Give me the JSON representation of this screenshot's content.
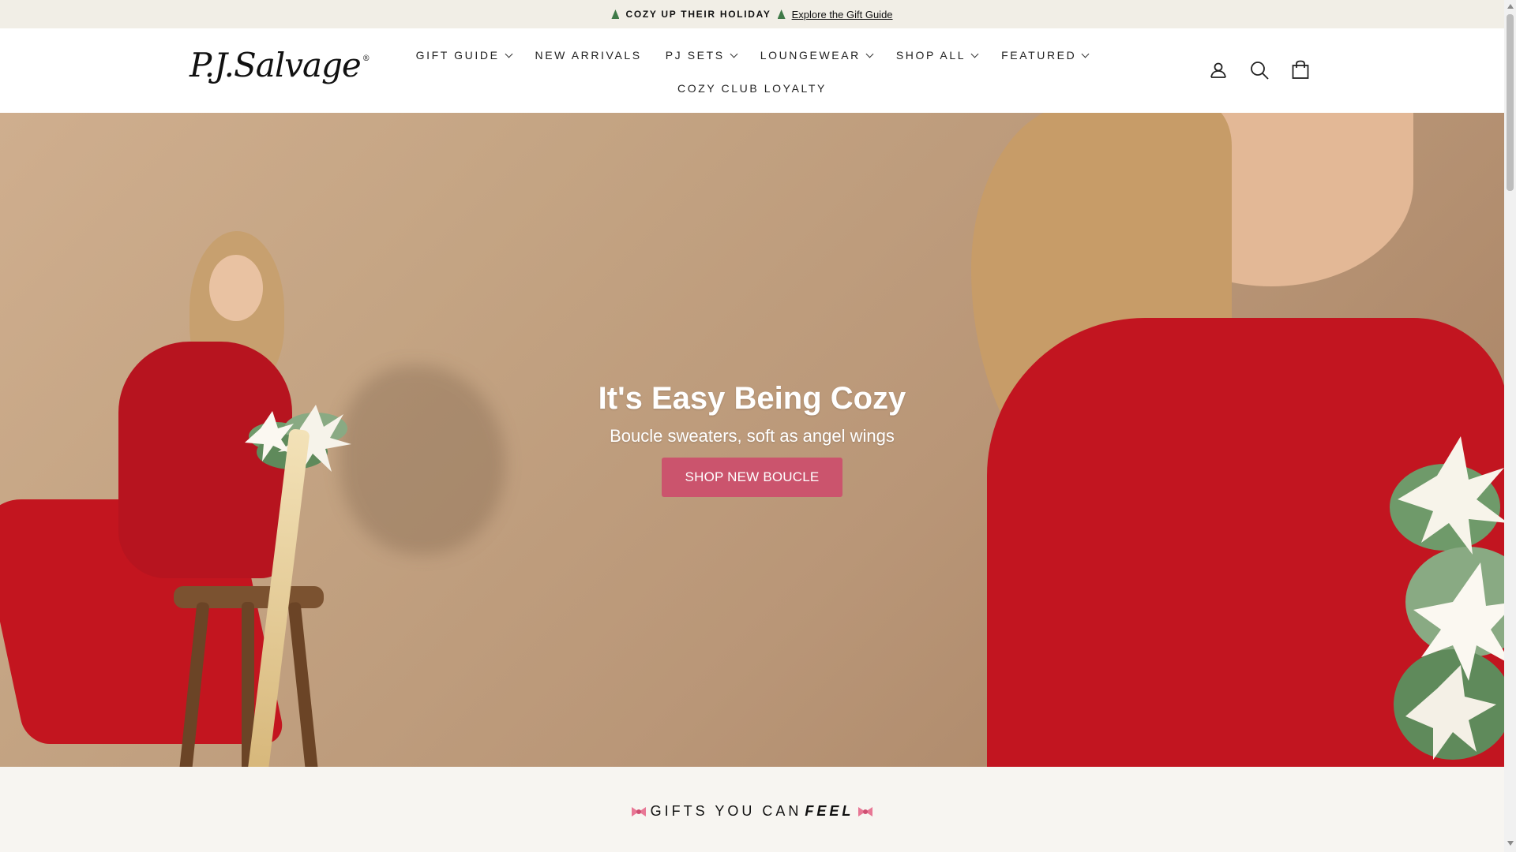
{
  "announcement": {
    "promo_text": "COZY UP THEIR HOLIDAY",
    "link_text": "Explore the Gift Guide",
    "icon": "christmas-tree-icon"
  },
  "header": {
    "logo_text": "P.J.Salvage",
    "logo_mark": "®",
    "nav": [
      {
        "label": "GIFT GUIDE",
        "has_dropdown": true
      },
      {
        "label": "NEW ARRIVALS",
        "has_dropdown": false
      },
      {
        "label": "PJ SETS",
        "has_dropdown": true
      },
      {
        "label": "LOUNGEWEAR",
        "has_dropdown": true
      },
      {
        "label": "SHOP ALL",
        "has_dropdown": true
      },
      {
        "label": "FEATURED",
        "has_dropdown": true
      },
      {
        "label": "COZY CLUB LOYALTY",
        "has_dropdown": false
      }
    ],
    "icons": [
      "account-icon",
      "search-icon",
      "shopping-bag-icon"
    ]
  },
  "hero": {
    "title": "It's Easy Being Cozy",
    "subtitle": "Boucle sweaters, soft as angel wings",
    "cta_label": "SHOP NEW BOUCLE"
  },
  "section": {
    "title_start": "GIFTS YOU CAN",
    "title_emphasis": "FEEL",
    "decoration": "bow-icon"
  },
  "colors": {
    "announcement_bg": "#f1eee6",
    "hero_button": "#cb546d",
    "sweater_red": "#c21520",
    "page_bg": "#f7f5f1"
  }
}
